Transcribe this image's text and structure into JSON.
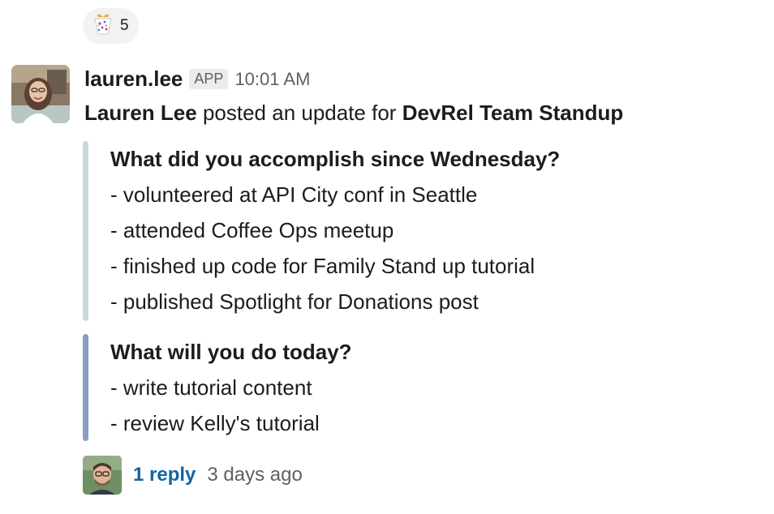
{
  "reaction": {
    "icon": "confetti-gift-emoji",
    "count": "5"
  },
  "message": {
    "username": "lauren.lee",
    "app_badge": "APP",
    "timestamp": "10:01 AM",
    "intro": {
      "author": "Lauren Lee",
      "middle": " posted an update for ",
      "channel": "DevRel Team Standup"
    },
    "sections": [
      {
        "title": "What did you accomplish since Wednesday?",
        "color": "#c8d9dc",
        "items": [
          "- volunteered at API City conf in Seattle",
          "- attended Coffee Ops meetup",
          "- finished up code for Family Stand up tutorial",
          "- published Spotlight for Donations post"
        ]
      },
      {
        "title": "What will you do today?",
        "color": "#8b9ec3",
        "items": [
          "- write tutorial content",
          "- review Kelly's tutorial"
        ]
      }
    ]
  },
  "thread": {
    "reply_label": "1 reply",
    "reply_time": "3 days ago"
  }
}
